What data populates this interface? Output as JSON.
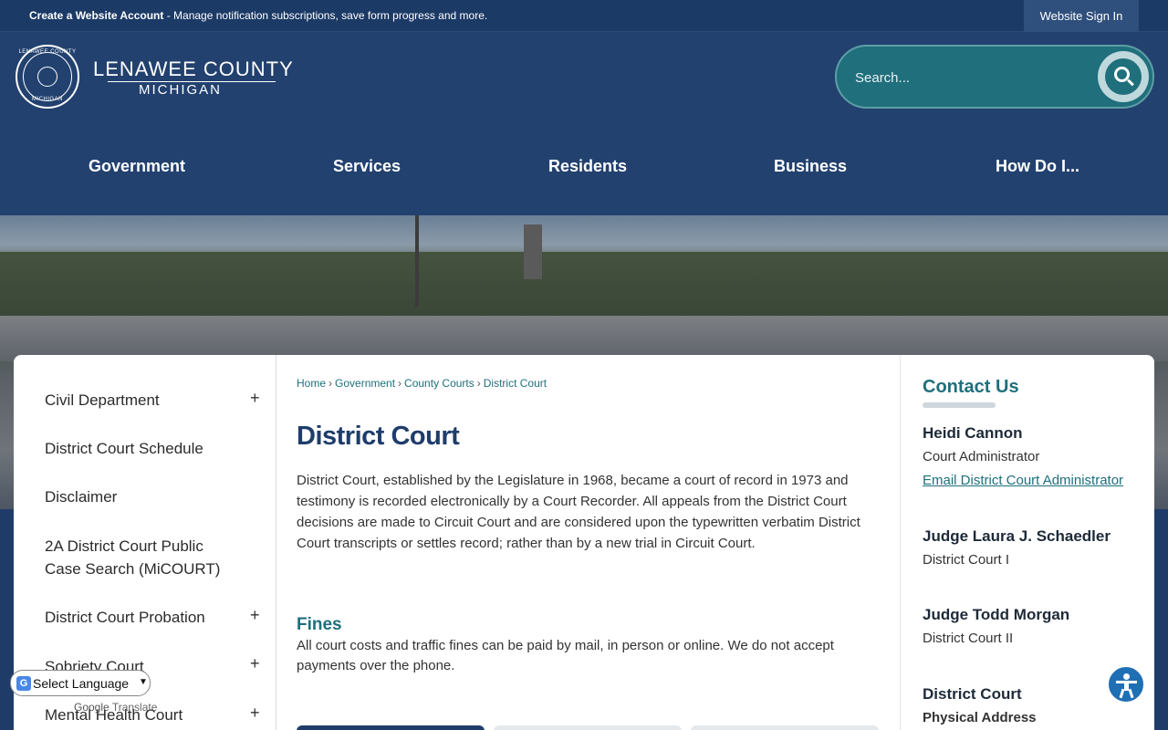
{
  "topbar": {
    "create_account": "Create a Website Account",
    "message": " - Manage notification subscriptions, save form progress and more.",
    "sign_in": "Website Sign In"
  },
  "logo": {
    "seal_top": "LENAWEE COUNTY",
    "seal_bottom": "MICHIGAN",
    "title": "LENAWEE COUNTY",
    "subtitle": "MICHIGAN"
  },
  "search": {
    "placeholder": "Search..."
  },
  "nav": {
    "items": [
      "Government",
      "Services",
      "Residents",
      "Business",
      "How Do I..."
    ]
  },
  "sidebar": {
    "items": [
      {
        "label": "Civil Department",
        "expandable": true
      },
      {
        "label": "District Court Schedule",
        "expandable": false
      },
      {
        "label": "Disclaimer",
        "expandable": false
      },
      {
        "label": "2A District Court Public Case Search (MiCOURT)",
        "expandable": false
      },
      {
        "label": "District Court Probation",
        "expandable": true
      },
      {
        "label": "Sobriety Court",
        "expandable": true
      },
      {
        "label": "Mental Health Court",
        "expandable": true
      }
    ],
    "expand_symbol": "+"
  },
  "breadcrumb": [
    "Home",
    "Government",
    "County Courts",
    "District Court"
  ],
  "breadcrumb_sep": "›",
  "main": {
    "title": "District Court",
    "intro": "District Court, established by the Legislature in 1968, became a court of record in 1973 and testimony is recorded electronically by a Court Recorder. All appeals from the District Court decisions are made to Circuit Court and are considered upon the typewritten verbatim District Court transcripts or settles record; rather than by a new trial in Circuit Court.",
    "fines_title": "Fines",
    "fines_body": "All court costs and traffic fines can be paid by mail, in person or online. We do not accept payments over the phone."
  },
  "contact": {
    "title": "Contact Us",
    "people": [
      {
        "name": "Heidi Cannon",
        "role": "Court Administrator",
        "link": "Email District Court Administrator"
      },
      {
        "name": "Judge Laura J. Schaedler",
        "role": "District Court I"
      },
      {
        "name": "Judge Todd Morgan",
        "role": "District Court II"
      },
      {
        "name": "District Court",
        "role": "Physical Address"
      }
    ]
  },
  "translate": {
    "select_label": "Select Language",
    "powered_by": "Google",
    "translate_word": "Translate"
  },
  "colors": {
    "navy": "#22416f",
    "teal": "#1f6f7c",
    "title_navy": "#1e3d6b"
  },
  "icons": [
    "search-icon",
    "accessibility-icon",
    "google-translate-icon",
    "plus-icon"
  ]
}
